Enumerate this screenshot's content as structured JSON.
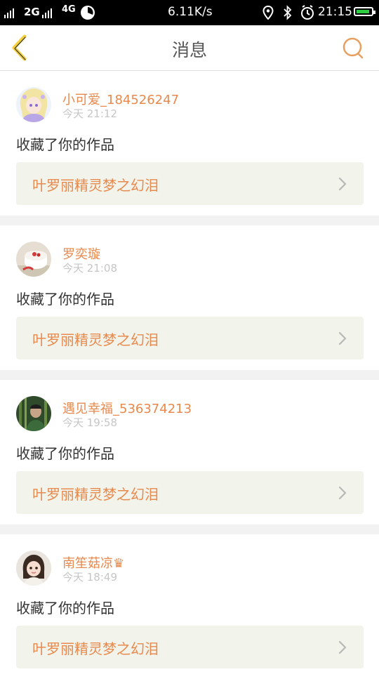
{
  "status_bar": {
    "network_1": "2G",
    "network_2": "4G",
    "speed": "6.11K/s",
    "time": "21:15",
    "battery_level": 0.9,
    "icons": [
      "signal-icon",
      "data-icon",
      "clock-app-icon",
      "location-icon",
      "bluetooth-icon",
      "alarm-icon",
      "battery-icon"
    ]
  },
  "header": {
    "title": "消息",
    "back_icon": "chevron-left-icon",
    "search_icon": "search-icon",
    "accent_color": "#e8894d"
  },
  "messages": [
    {
      "username": "小可爱_184526247",
      "time": "今天 21:12",
      "action": "收藏了你的作品",
      "work_title": "叶罗丽精灵梦之幻泪"
    },
    {
      "username": "罗奕璇",
      "time": "今天 21:08",
      "action": "收藏了你的作品",
      "work_title": "叶罗丽精灵梦之幻泪"
    },
    {
      "username": "遇见幸福_536374213",
      "time": "今天 19:58",
      "action": "收藏了你的作品",
      "work_title": "叶罗丽精灵梦之幻泪"
    },
    {
      "username": "南笙菇凉♛",
      "time": "今天 18:49",
      "action": "收藏了你的作品",
      "work_title": "叶罗丽精灵梦之幻泪"
    }
  ]
}
